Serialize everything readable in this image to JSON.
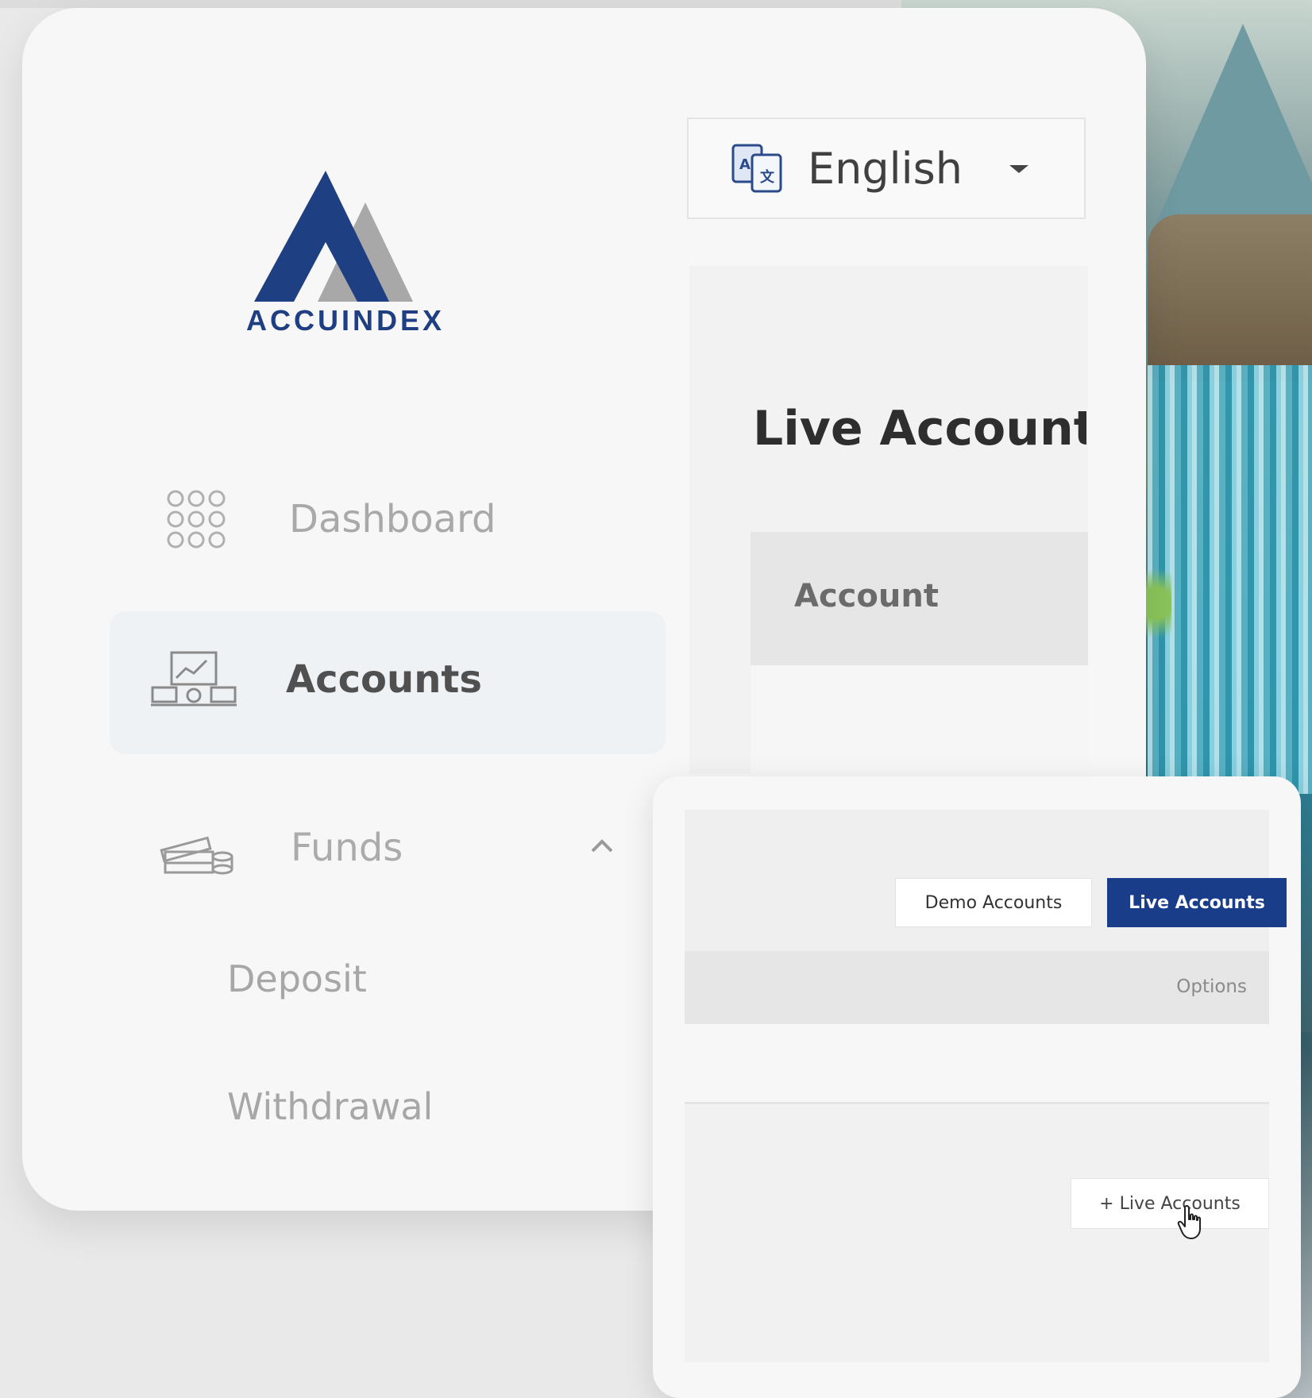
{
  "brand": {
    "name": "ACCUINDEX",
    "primary_color": "#1f3f83",
    "secondary_color": "#a8a8a8"
  },
  "language_selector": {
    "icon": "translate-icon",
    "value": "English",
    "caret_icon": "caret-down-icon"
  },
  "sidebar": {
    "items": [
      {
        "label": "Dashboard",
        "icon": "grid-dots-icon",
        "active": false
      },
      {
        "label": "Accounts",
        "icon": "accounts-icon",
        "active": true
      },
      {
        "label": "Funds",
        "icon": "money-stack-icon",
        "active": false,
        "expanded": true,
        "chevron_icon": "chevron-up-icon",
        "children": [
          {
            "label": "Deposit"
          },
          {
            "label": "Withdrawal"
          }
        ]
      }
    ]
  },
  "main": {
    "title": "Live Account",
    "table_header": "Account"
  },
  "overlay": {
    "tabs": [
      {
        "label": "Demo Accounts",
        "active": false
      },
      {
        "label": "Live Accounts",
        "active": true
      }
    ],
    "table_header": "Options",
    "add_button_label": "+ Live Accounts",
    "cursor_icon": "hand-pointer-icon",
    "active_tab_color": "#1a3d8a"
  }
}
